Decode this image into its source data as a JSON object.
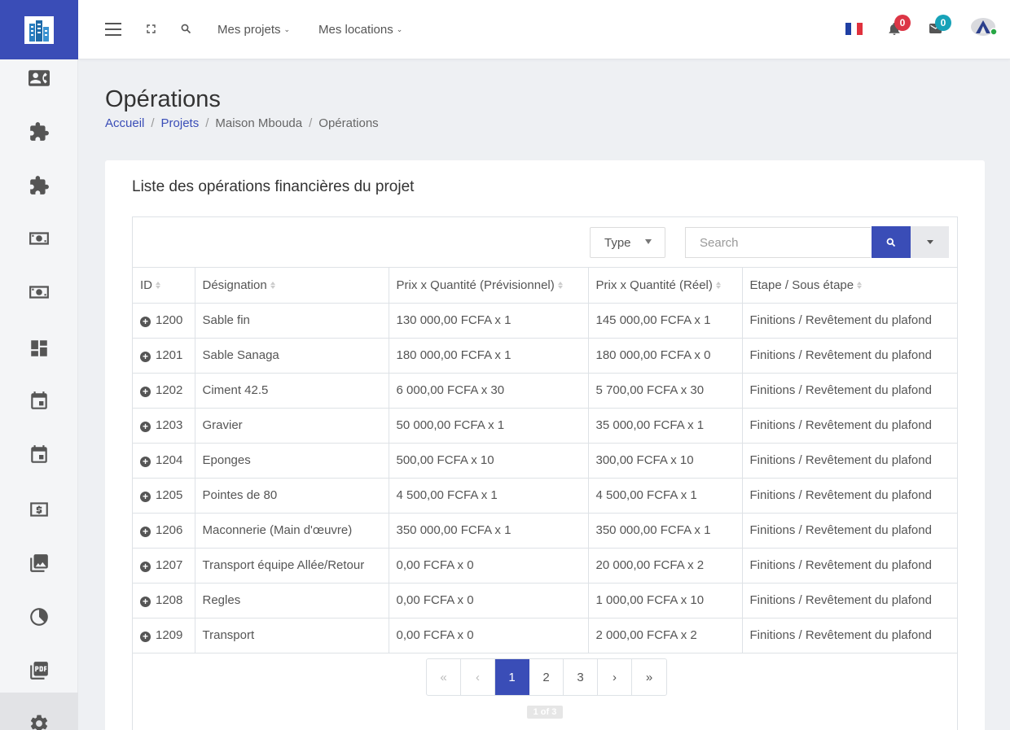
{
  "header": {
    "nav": [
      {
        "label": "Mes projets"
      },
      {
        "label": "Mes locations"
      }
    ],
    "notifications_count": "0",
    "messages_count": "0"
  },
  "page": {
    "title": "Opérations",
    "breadcrumb": [
      "Accueil",
      "/",
      "Projets",
      "/",
      "Maison Mbouda",
      "/",
      "Opérations"
    ]
  },
  "card": {
    "title": "Liste des opérations financières du projet",
    "type_filter": "Type",
    "search_placeholder": "Search"
  },
  "table": {
    "columns": [
      "ID",
      "Désignation",
      "Prix x Quantité (Prévisionnel)",
      "Prix x Quantité (Réel)",
      "Etape / Sous étape"
    ],
    "rows": [
      {
        "id": "1200",
        "designation": "Sable fin",
        "prev": "130 000,00 FCFA x 1",
        "reel": "145 000,00 FCFA x 1",
        "etape": "Finitions / Revêtement du plafond"
      },
      {
        "id": "1201",
        "designation": "Sable Sanaga",
        "prev": "180 000,00 FCFA x 1",
        "reel": "180 000,00 FCFA x 0",
        "etape": "Finitions / Revêtement du plafond"
      },
      {
        "id": "1202",
        "designation": "Ciment 42.5",
        "prev": "6 000,00 FCFA x 30",
        "reel": "5 700,00 FCFA x 30",
        "etape": "Finitions / Revêtement du plafond"
      },
      {
        "id": "1203",
        "designation": "Gravier",
        "prev": "50 000,00 FCFA x 1",
        "reel": "35 000,00 FCFA x 1",
        "etape": "Finitions / Revêtement du plafond"
      },
      {
        "id": "1204",
        "designation": "Eponges",
        "prev": "500,00 FCFA x 10",
        "reel": "300,00 FCFA x 10",
        "etape": "Finitions / Revêtement du plafond"
      },
      {
        "id": "1205",
        "designation": "Pointes de 80",
        "prev": "4 500,00 FCFA x 1",
        "reel": "4 500,00 FCFA x 1",
        "etape": "Finitions / Revêtement du plafond"
      },
      {
        "id": "1206",
        "designation": "Maconnerie (Main d'œuvre)",
        "prev": "350 000,00 FCFA x 1",
        "reel": "350 000,00 FCFA x 1",
        "etape": "Finitions / Revêtement du plafond"
      },
      {
        "id": "1207",
        "designation": "Transport équipe Allée/Retour",
        "prev": "0,00 FCFA x 0",
        "reel": "20 000,00 FCFA x 2",
        "etape": "Finitions / Revêtement du plafond"
      },
      {
        "id": "1208",
        "designation": "Regles",
        "prev": "0,00 FCFA x 0",
        "reel": "1 000,00 FCFA x 10",
        "etape": "Finitions / Revêtement du plafond"
      },
      {
        "id": "1209",
        "designation": "Transport",
        "prev": "0,00 FCFA x 0",
        "reel": "2 000,00 FCFA x 2",
        "etape": "Finitions / Revêtement du plafond"
      }
    ]
  },
  "pagination": {
    "first": "«",
    "prev": "‹",
    "pages": [
      "1",
      "2",
      "3"
    ],
    "next": "›",
    "last": "»",
    "info": "1 of 3"
  },
  "sidebar": {
    "icons": [
      "contact-card-icon",
      "puzzle-icon",
      "puzzle-icon",
      "money-icon",
      "money-icon",
      "dashboard-icon",
      "calendar-icon",
      "calendar-icon",
      "dollar-icon",
      "photo-library-icon",
      "clock-icon",
      "pdf-icon",
      "settings-icon"
    ]
  },
  "colors": {
    "accent": "#3a4db7",
    "badge_red": "#dc3545",
    "badge_teal": "#17a2b8"
  }
}
